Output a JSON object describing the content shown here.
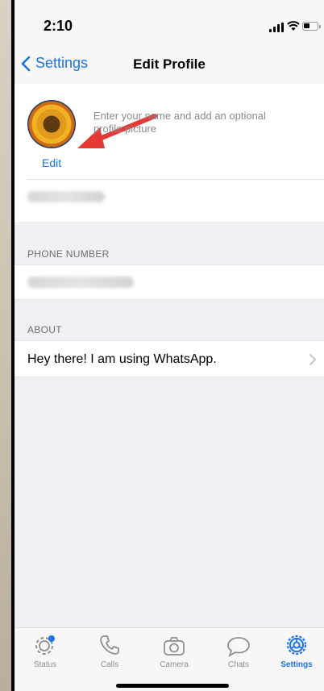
{
  "status_bar": {
    "time": "2:10"
  },
  "nav": {
    "back_label": "Settings",
    "title": "Edit Profile"
  },
  "profile": {
    "hint": "Enter your name and add an optional profile picture",
    "edit_label": "Edit"
  },
  "sections": {
    "phone_label": "PHONE NUMBER",
    "about_label": "ABOUT",
    "about_text": "Hey there! I am using WhatsApp."
  },
  "tabs": [
    {
      "label": "Status"
    },
    {
      "label": "Calls"
    },
    {
      "label": "Camera"
    },
    {
      "label": "Chats"
    },
    {
      "label": "Settings"
    }
  ],
  "colors": {
    "accent": "#1a73e8",
    "arrow": "#e53935"
  }
}
